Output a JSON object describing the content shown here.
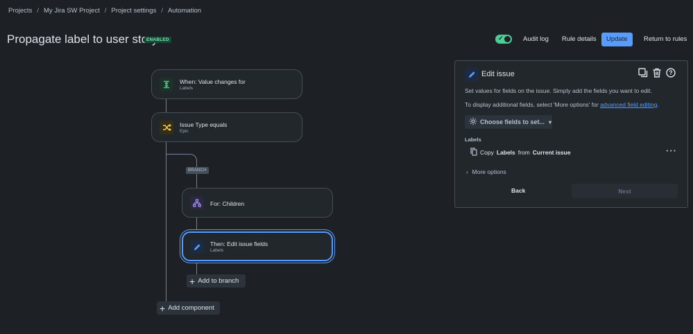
{
  "breadcrumb": [
    "Projects",
    "My Jira SW Project",
    "Project settings",
    "Automation"
  ],
  "header": {
    "title": "Propagate label to user story",
    "status_badge": "ENABLED",
    "audit_log": "Audit log",
    "rule_details": "Rule details",
    "update": "Update",
    "return": "Return to rules"
  },
  "flow": {
    "trigger": {
      "title": "When: Value changes for",
      "subtitle": "Labels",
      "icon": "value-change-icon",
      "color": "#4bce97"
    },
    "condition": {
      "title": "Issue Type equals",
      "subtitle": "Epic",
      "icon": "shuffle-icon",
      "color": "#f5cd47"
    },
    "branch_label": "BRANCH",
    "branch": {
      "title": "For: Children",
      "icon": "hierarchy-icon",
      "color": "#9f8fef"
    },
    "action": {
      "title": "Then: Edit issue fields",
      "subtitle": "Labels",
      "icon": "pencil-icon",
      "color": "#579dff"
    },
    "add_to_branch": "Add to branch",
    "add_component": "Add component"
  },
  "panel": {
    "title": "Edit issue",
    "desc1": "Set values for fields on the issue. Simply add the fields you want to edit.",
    "desc2_prefix": "To display additional fields, select 'More options' for ",
    "desc2_link": "advanced field editing",
    "desc2_suffix": ".",
    "choose_fields": "Choose fields to set...",
    "labels_heading": "Labels",
    "copy_word": "Copy",
    "copy_field": "Labels",
    "copy_from": "from",
    "copy_source": "Current issue",
    "more_options": "More options",
    "back": "Back",
    "next": "Next"
  }
}
